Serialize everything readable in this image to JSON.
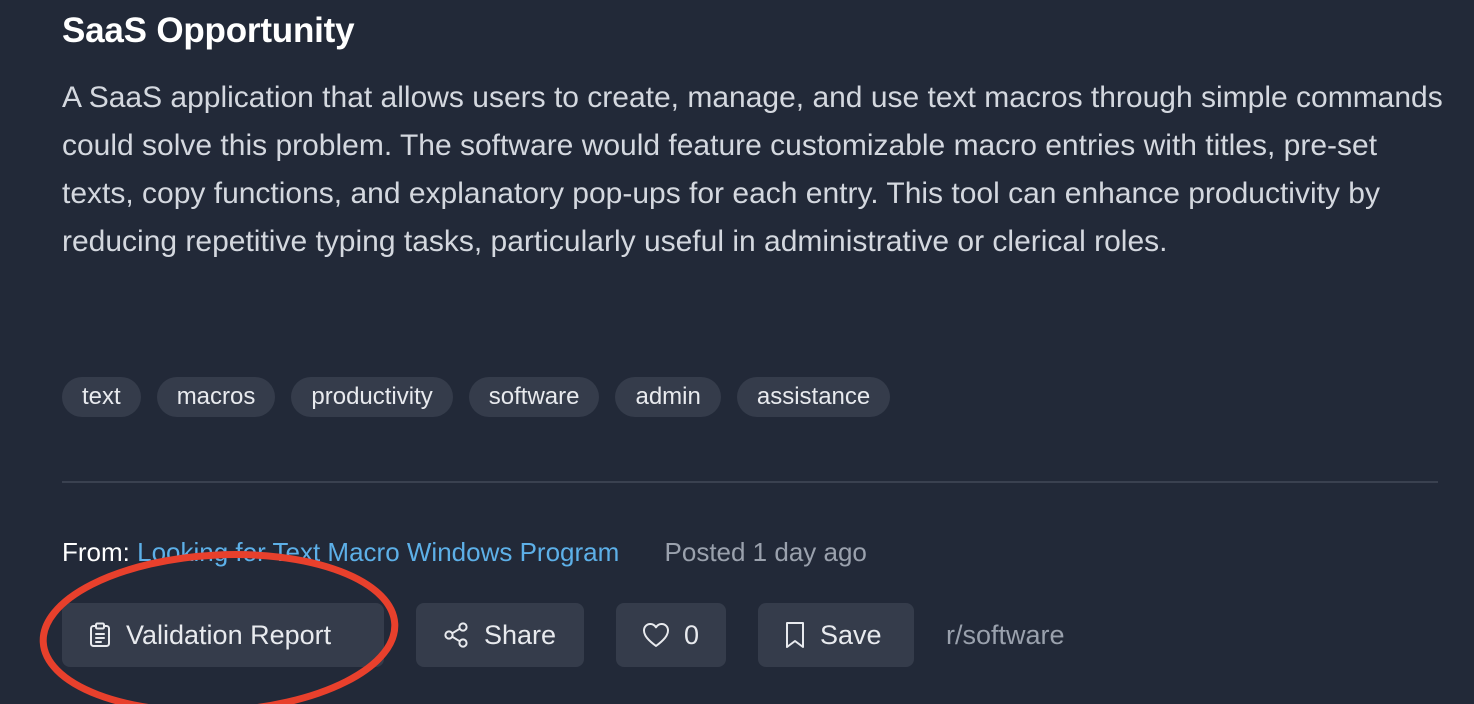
{
  "post": {
    "title": "SaaS Opportunity",
    "description": "A SaaS application that allows users to create, manage, and use text macros through simple commands could solve this problem. The software would feature customizable macro entries with titles, pre-set texts, copy functions, and explanatory pop-ups for each entry. This tool can enhance productivity by reducing repetitive typing tasks, particularly useful in administrative or clerical roles.",
    "tags": [
      "text",
      "macros",
      "productivity",
      "software",
      "admin",
      "assistance"
    ]
  },
  "meta": {
    "from_label": "From:",
    "source_link": "Looking for Text Macro Windows Program",
    "posted": "Posted 1 day ago"
  },
  "actions": {
    "report_label": "Validation Report",
    "report_icon": "clipboard-icon",
    "share_label": "Share",
    "share_icon": "share-icon",
    "like_count": "0",
    "like_icon": "heart-icon",
    "save_label": "Save",
    "save_icon": "bookmark-icon",
    "subreddit": "r/software"
  },
  "colors": {
    "background": "#222938",
    "button_bg": "#353c4b",
    "link": "#5db0e8",
    "muted": "#9aa1ad",
    "annotation": "#e8402c"
  }
}
